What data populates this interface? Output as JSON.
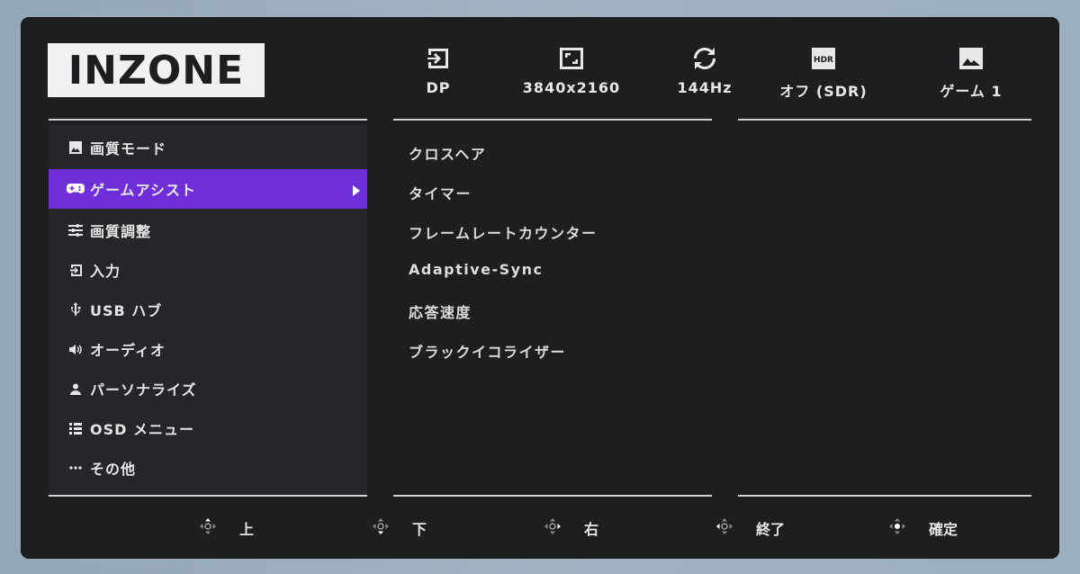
{
  "brand": {
    "logo_text": "INZONE"
  },
  "status_bar": [
    {
      "icon": "input-icon",
      "label": "DP"
    },
    {
      "icon": "resolution-icon",
      "label": "3840x2160"
    },
    {
      "icon": "refresh-rate-icon",
      "label": "144Hz"
    },
    {
      "icon": "hdr-icon",
      "icon_text": "HDR",
      "label": "オフ (SDR)"
    },
    {
      "icon": "picture-icon",
      "label": "ゲーム 1"
    }
  ],
  "menu": [
    {
      "icon": "picture-icon",
      "label": "画質モード"
    },
    {
      "icon": "gamepad-icon",
      "label": "ゲームアシスト",
      "selected": true
    },
    {
      "icon": "sliders-icon",
      "label": "画質調整"
    },
    {
      "icon": "input-icon",
      "label": "入力"
    },
    {
      "icon": "usb-icon",
      "label": "USB ハブ"
    },
    {
      "icon": "speaker-icon",
      "label": "オーディオ"
    },
    {
      "icon": "person-icon",
      "label": "パーソナライズ"
    },
    {
      "icon": "list-icon",
      "label": "OSD メニュー"
    },
    {
      "icon": "more-icon",
      "label": "その他"
    }
  ],
  "submenu": [
    "クロスヘア",
    "タイマー",
    "フレームレートカウンター",
    "Adaptive-Sync",
    "応答速度",
    "ブラックイコライザー"
  ],
  "nav": [
    {
      "icon": "joystick-up-icon",
      "label": "上"
    },
    {
      "icon": "joystick-down-icon",
      "label": "下"
    },
    {
      "icon": "joystick-right-icon",
      "label": "右"
    },
    {
      "icon": "joystick-left-icon",
      "label": "終了"
    },
    {
      "icon": "joystick-press-icon",
      "label": "確定"
    }
  ],
  "colors": {
    "panel": "#1d1e20",
    "menu_bg": "#25262a",
    "accent": "#6f2fd8",
    "text": "#e6e6e6"
  }
}
